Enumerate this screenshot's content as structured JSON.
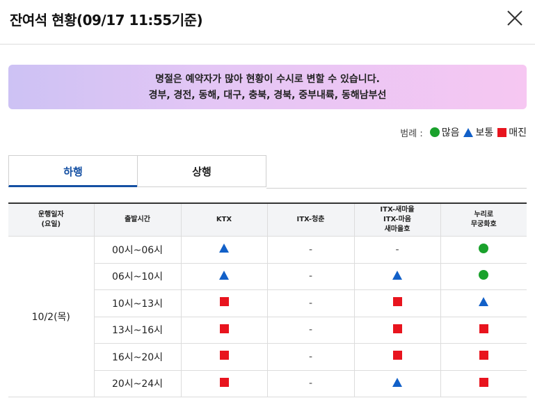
{
  "header": {
    "title": "잔여석 현황(09/17 11:55기준)",
    "close_icon": "close-icon"
  },
  "notice": {
    "line1": "명절은 예약자가 많아 현황이 수시로 변할 수 있습니다.",
    "line2": "경부, 경전, 동해, 대구, 충북, 경북, 중부내륙, 동해남부선"
  },
  "legend": {
    "label": "범례 :",
    "items": [
      {
        "symbol": "circle",
        "label": "많음",
        "color": "#1aa12c"
      },
      {
        "symbol": "triangle",
        "label": "보통",
        "color": "#1260c8"
      },
      {
        "symbol": "square",
        "label": "매진",
        "color": "#e8141e"
      }
    ]
  },
  "tabs": [
    {
      "label": "하행",
      "active": true
    },
    {
      "label": "상행",
      "active": false
    }
  ],
  "table": {
    "headers": {
      "date": [
        "운행일자",
        "(요일)"
      ],
      "time": "출발시간",
      "ktx": "KTX",
      "itx_cc": "ITX-청춘",
      "itx_saemaeul": [
        "ITX-새마을",
        "ITX-마음",
        "새마을호"
      ],
      "nuriro": [
        "누리로",
        "무궁화호"
      ]
    },
    "date": "10/2(목)",
    "rows": [
      {
        "time": "00시~06시",
        "ktx": "triangle",
        "itx_cc": "-",
        "itx_saemaeul": "-",
        "nuriro": "circle"
      },
      {
        "time": "06시~10시",
        "ktx": "triangle",
        "itx_cc": "-",
        "itx_saemaeul": "triangle",
        "nuriro": "circle"
      },
      {
        "time": "10시~13시",
        "ktx": "square",
        "itx_cc": "-",
        "itx_saemaeul": "square",
        "nuriro": "triangle"
      },
      {
        "time": "13시~16시",
        "ktx": "square",
        "itx_cc": "-",
        "itx_saemaeul": "square",
        "nuriro": "square"
      },
      {
        "time": "16시~20시",
        "ktx": "square",
        "itx_cc": "-",
        "itx_saemaeul": "square",
        "nuriro": "square"
      },
      {
        "time": "20시~24시",
        "ktx": "square",
        "itx_cc": "-",
        "itx_saemaeul": "triangle",
        "nuriro": "square"
      }
    ]
  }
}
